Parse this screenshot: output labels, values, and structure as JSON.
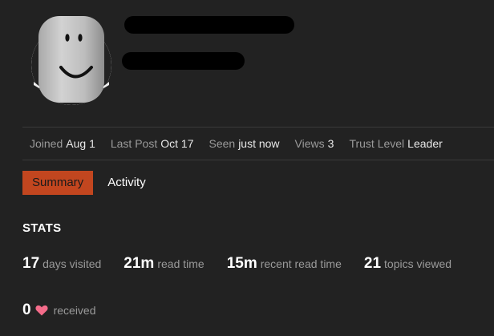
{
  "profile": {
    "avatar_icon": "smiley-face-avatar-icon"
  },
  "meta": {
    "items": [
      {
        "label": "Joined",
        "value": "Aug 1"
      },
      {
        "label": "Last Post",
        "value": "Oct 17"
      },
      {
        "label": "Seen",
        "value": "just now"
      },
      {
        "label": "Views",
        "value": "3"
      },
      {
        "label": "Trust Level",
        "value": "Leader"
      }
    ]
  },
  "tabs": [
    {
      "label": "Summary",
      "active": true
    },
    {
      "label": "Activity",
      "active": false
    }
  ],
  "stats": {
    "title": "STATS",
    "items": [
      {
        "value": "17",
        "label": "days visited"
      },
      {
        "value": "21m",
        "label": "read time"
      },
      {
        "value": "15m",
        "label": "recent read time"
      },
      {
        "value": "21",
        "label": "topics viewed"
      }
    ],
    "likes": {
      "value": "0",
      "icon": "heart-icon",
      "label": "received"
    }
  },
  "colors": {
    "background": "#222222",
    "accent": "#c2461f",
    "heart": "#f46c8a",
    "muted_text": "#9a9a9a"
  }
}
